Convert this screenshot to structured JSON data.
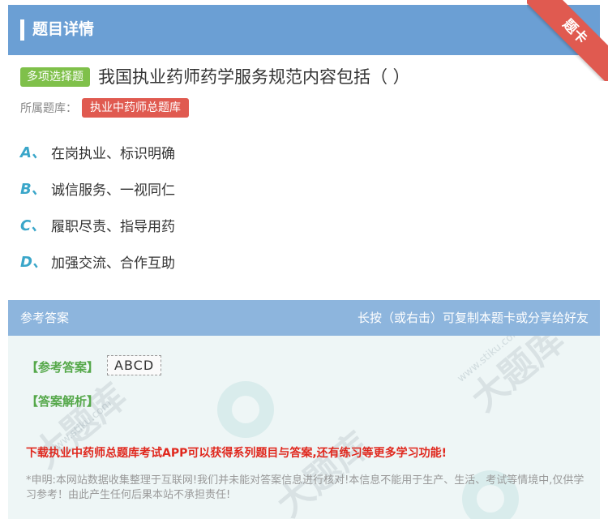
{
  "header": {
    "title": "题目详情",
    "corner_badge": "题卡"
  },
  "question": {
    "type": "多项选择题",
    "text": "我国执业药师药学服务规范内容包括（ ）",
    "bank_label": "所属题库：",
    "bank_name": "执业中药师总题库"
  },
  "options": [
    {
      "letter": "A、",
      "text": "在岗执业、标识明确"
    },
    {
      "letter": "B、",
      "text": "诚信服务、一视同仁"
    },
    {
      "letter": "C、",
      "text": "履职尽责、指导用药"
    },
    {
      "letter": "D、",
      "text": "加强交流、合作互助"
    }
  ],
  "answer": {
    "head_left": "参考答案",
    "head_right": "长按（或右击）可复制本题卡或分享给好友",
    "ref_label": "【参考答案】",
    "ref_value": "ABCD",
    "analysis_label": "【答案解析】",
    "promo": "下载执业中药师总题库考试APP可以获得系列题目与答案,还有练习等更多学习功能!",
    "disclaimer": "*申明:本网站数据收集整理于互联网!我们并未能对答案信息进行核对!本信息不能用于生产、生活、考试等情境中,仅供学习参考！由此产生任何后果本站不承担责任!"
  },
  "watermark": {
    "text": "大题库",
    "url": "www.stiku.com"
  },
  "colors": {
    "header_bg": "#6b9fd4",
    "answer_head_bg": "#8db5dd",
    "type_tag": "#7fc04a",
    "bank_tag": "#e05a50",
    "option_letter": "#3aa6c9",
    "answer_label": "#55a84a",
    "promo": "#e0281e"
  }
}
